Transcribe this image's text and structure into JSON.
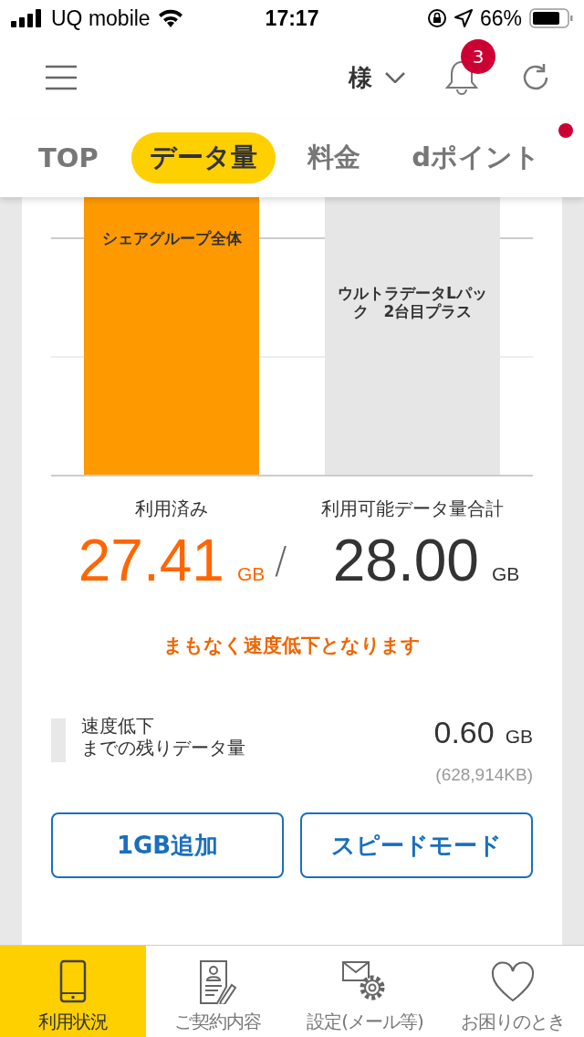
{
  "status_bar": {
    "carrier": "UQ mobile",
    "time": "17:17",
    "battery": "66%"
  },
  "header": {
    "honorific": "様",
    "notification_count": "3"
  },
  "tabs": [
    {
      "label": "TOP",
      "selected": false,
      "dot": false
    },
    {
      "label": "データ量",
      "selected": true,
      "dot": false
    },
    {
      "label": "料金",
      "selected": false,
      "dot": false
    },
    {
      "label": "dポイント",
      "selected": false,
      "dot": true
    }
  ],
  "bars": [
    {
      "label": "シェアグループ全体",
      "color": "#ff9900"
    },
    {
      "label": "ウルトラデータLパック　2台目プラス",
      "color": "#e6e6e6"
    }
  ],
  "used": {
    "label": "利用済み",
    "value": "27.41",
    "unit": "GB"
  },
  "separator": "/",
  "total": {
    "label": "利用可能データ量合計",
    "value": "28.00",
    "unit": "GB"
  },
  "warning": "まもなく速度低下となります",
  "remaining": {
    "label_lines": [
      "速度低下",
      "までの残りデータ量"
    ],
    "value": "0.60",
    "unit": "GB",
    "detail": "(628,914KB)"
  },
  "actions": [
    "1GB追加",
    "スピードモード"
  ],
  "bottom_nav": [
    {
      "label": "利用状況",
      "selected": true,
      "kind": "phone"
    },
    {
      "label": "ご契約内容",
      "selected": false,
      "kind": "contract"
    },
    {
      "label": "設定(メール等)",
      "selected": false,
      "kind": "settings"
    },
    {
      "label": "お困りのとき",
      "selected": false,
      "kind": "help"
    }
  ]
}
